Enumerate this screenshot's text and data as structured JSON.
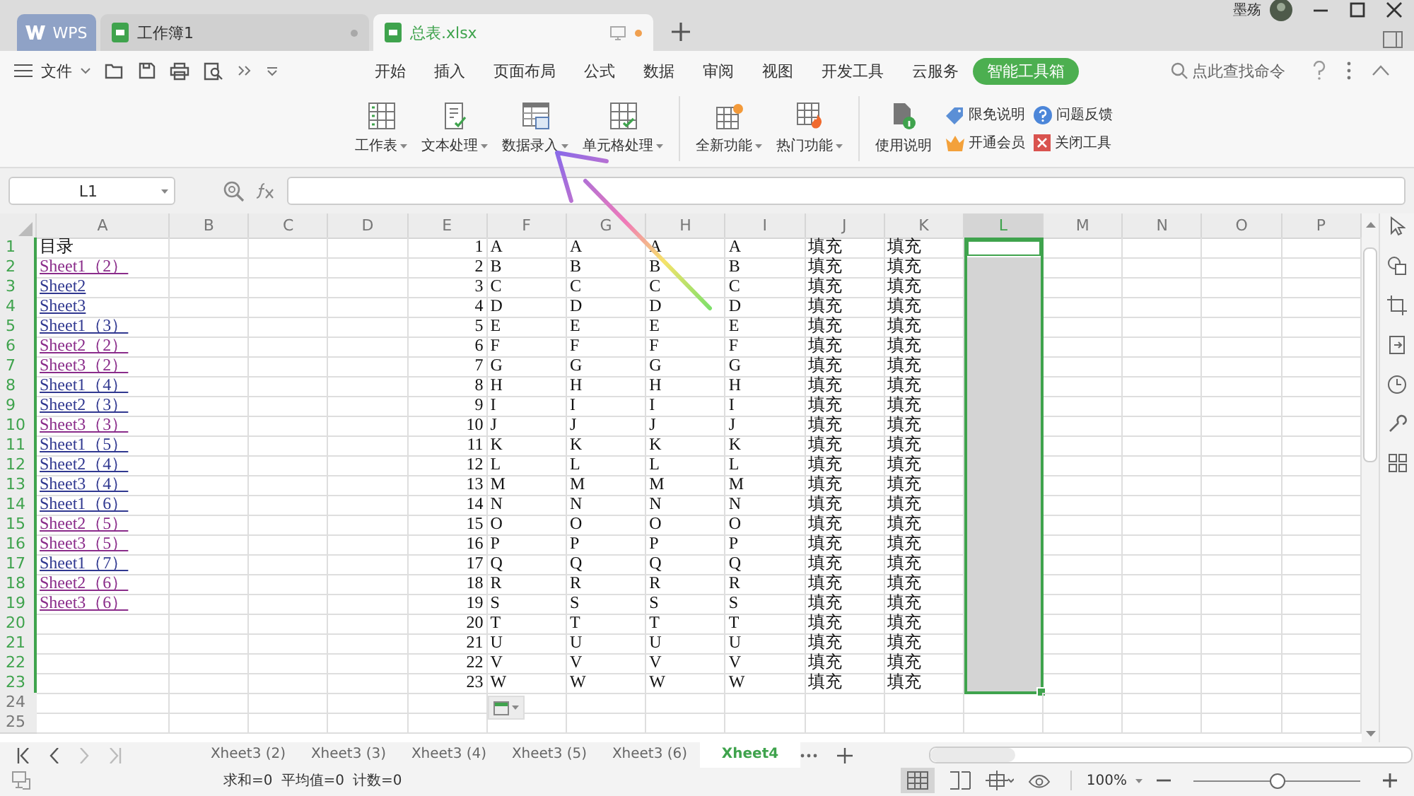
{
  "title_bar": {
    "app_tab": "WPS",
    "tabs": [
      {
        "label": "工作簿1",
        "selected": false
      },
      {
        "label": "总表.xlsx",
        "selected": true
      }
    ],
    "user": "墨殇"
  },
  "menu": {
    "file": "文件",
    "tabs": [
      {
        "label": "开始",
        "selected": false
      },
      {
        "label": "插入",
        "selected": false
      },
      {
        "label": "页面布局",
        "selected": false
      },
      {
        "label": "公式",
        "selected": false
      },
      {
        "label": "数据",
        "selected": false
      },
      {
        "label": "审阅",
        "selected": false
      },
      {
        "label": "视图",
        "selected": false
      },
      {
        "label": "开发工具",
        "selected": false
      },
      {
        "label": "云服务",
        "selected": false
      },
      {
        "label": "智能工具箱",
        "selected": true
      }
    ],
    "search": "点此查找命令"
  },
  "ribbon": {
    "large": [
      {
        "label": "工作表",
        "dropdown": true
      },
      {
        "label": "文本处理",
        "dropdown": true
      },
      {
        "label": "数据录入",
        "dropdown": true
      },
      {
        "label": "单元格处理",
        "dropdown": true
      },
      {
        "label": "全新功能",
        "dropdown": true
      },
      {
        "label": "热门功能",
        "dropdown": true
      },
      {
        "label": "使用说明",
        "dropdown": false
      }
    ],
    "small": [
      "限免说明",
      "问题反馈",
      "开通会员",
      "关闭工具"
    ]
  },
  "formula_bar": {
    "name_box": "L1"
  },
  "grid": {
    "columns": [
      {
        "label": "A",
        "selected": false
      },
      {
        "label": "B",
        "selected": false
      },
      {
        "label": "C",
        "selected": false
      },
      {
        "label": "D",
        "selected": false
      },
      {
        "label": "E",
        "selected": false
      },
      {
        "label": "F",
        "selected": false
      },
      {
        "label": "G",
        "selected": false
      },
      {
        "label": "H",
        "selected": false
      },
      {
        "label": "I",
        "selected": false
      },
      {
        "label": "J",
        "selected": false
      },
      {
        "label": "K",
        "selected": false
      },
      {
        "label": "L",
        "selected": true
      },
      {
        "label": "M",
        "selected": false
      },
      {
        "label": "N",
        "selected": false
      },
      {
        "label": "O",
        "selected": false
      },
      {
        "label": "P",
        "selected": false
      }
    ],
    "rows": [
      {
        "number": "1",
        "selected": true,
        "active": true,
        "a": {
          "kind": "text",
          "text": "目录"
        },
        "e": "1",
        "f": "A",
        "g": "A",
        "h": "A",
        "i": "A",
        "j": "填充",
        "k": "填充"
      },
      {
        "number": "2",
        "selected": true,
        "active": false,
        "a": {
          "kind": "link",
          "text": "Sheet1（2）",
          "visited": true
        },
        "e": "2",
        "f": "B",
        "g": "B",
        "h": "B",
        "i": "B",
        "j": "填充",
        "k": "填充"
      },
      {
        "number": "3",
        "selected": true,
        "active": false,
        "a": {
          "kind": "link",
          "text": "Sheet2",
          "visited": false
        },
        "e": "3",
        "f": "C",
        "g": "C",
        "h": "C",
        "i": "C",
        "j": "填充",
        "k": "填充"
      },
      {
        "number": "4",
        "selected": true,
        "active": false,
        "a": {
          "kind": "link",
          "text": "Sheet3",
          "visited": false
        },
        "e": "4",
        "f": "D",
        "g": "D",
        "h": "D",
        "i": "D",
        "j": "填充",
        "k": "填充"
      },
      {
        "number": "5",
        "selected": true,
        "active": false,
        "a": {
          "kind": "link",
          "text": "Sheet1（3）",
          "visited": false
        },
        "e": "5",
        "f": "E",
        "g": "E",
        "h": "E",
        "i": "E",
        "j": "填充",
        "k": "填充"
      },
      {
        "number": "6",
        "selected": true,
        "active": false,
        "a": {
          "kind": "link",
          "text": "Sheet2（2）",
          "visited": true
        },
        "e": "6",
        "f": "F",
        "g": "F",
        "h": "F",
        "i": "F",
        "j": "填充",
        "k": "填充"
      },
      {
        "number": "7",
        "selected": true,
        "active": false,
        "a": {
          "kind": "link",
          "text": "Sheet3（2）",
          "visited": true
        },
        "e": "7",
        "f": "G",
        "g": "G",
        "h": "G",
        "i": "G",
        "j": "填充",
        "k": "填充"
      },
      {
        "number": "8",
        "selected": true,
        "active": false,
        "a": {
          "kind": "link",
          "text": "Sheet1（4）",
          "visited": false
        },
        "e": "8",
        "f": "H",
        "g": "H",
        "h": "H",
        "i": "H",
        "j": "填充",
        "k": "填充"
      },
      {
        "number": "9",
        "selected": true,
        "active": false,
        "a": {
          "kind": "link",
          "text": "Sheet2（3）",
          "visited": false
        },
        "e": "9",
        "f": "I",
        "g": "I",
        "h": "I",
        "i": "I",
        "j": "填充",
        "k": "填充"
      },
      {
        "number": "10",
        "selected": true,
        "active": false,
        "a": {
          "kind": "link",
          "text": "Sheet3（3）",
          "visited": true
        },
        "e": "10",
        "f": "J",
        "g": "J",
        "h": "J",
        "i": "J",
        "j": "填充",
        "k": "填充"
      },
      {
        "number": "11",
        "selected": true,
        "active": false,
        "a": {
          "kind": "link",
          "text": "Sheet1（5）",
          "visited": false
        },
        "e": "11",
        "f": "K",
        "g": "K",
        "h": "K",
        "i": "K",
        "j": "填充",
        "k": "填充"
      },
      {
        "number": "12",
        "selected": true,
        "active": false,
        "a": {
          "kind": "link",
          "text": "Sheet2（4）",
          "visited": false
        },
        "e": "12",
        "f": "L",
        "g": "L",
        "h": "L",
        "i": "L",
        "j": "填充",
        "k": "填充"
      },
      {
        "number": "13",
        "selected": true,
        "active": false,
        "a": {
          "kind": "link",
          "text": "Sheet3（4）",
          "visited": false
        },
        "e": "13",
        "f": "M",
        "g": "M",
        "h": "M",
        "i": "M",
        "j": "填充",
        "k": "填充"
      },
      {
        "number": "14",
        "selected": true,
        "active": false,
        "a": {
          "kind": "link",
          "text": "Sheet1（6）",
          "visited": false
        },
        "e": "14",
        "f": "N",
        "g": "N",
        "h": "N",
        "i": "N",
        "j": "填充",
        "k": "填充"
      },
      {
        "number": "15",
        "selected": true,
        "active": false,
        "a": {
          "kind": "link",
          "text": "Sheet2（5）",
          "visited": true
        },
        "e": "15",
        "f": "O",
        "g": "O",
        "h": "O",
        "i": "O",
        "j": "填充",
        "k": "填充"
      },
      {
        "number": "16",
        "selected": true,
        "active": false,
        "a": {
          "kind": "link",
          "text": "Sheet3（5）",
          "visited": true
        },
        "e": "16",
        "f": "P",
        "g": "P",
        "h": "P",
        "i": "P",
        "j": "填充",
        "k": "填充"
      },
      {
        "number": "17",
        "selected": true,
        "active": false,
        "a": {
          "kind": "link",
          "text": "Sheet1（7）",
          "visited": false
        },
        "e": "17",
        "f": "Q",
        "g": "Q",
        "h": "Q",
        "i": "Q",
        "j": "填充",
        "k": "填充"
      },
      {
        "number": "18",
        "selected": true,
        "active": false,
        "a": {
          "kind": "link",
          "text": "Sheet2（6）",
          "visited": true
        },
        "e": "18",
        "f": "R",
        "g": "R",
        "h": "R",
        "i": "R",
        "j": "填充",
        "k": "填充"
      },
      {
        "number": "19",
        "selected": true,
        "active": false,
        "a": {
          "kind": "link",
          "text": "Sheet3（6）",
          "visited": true
        },
        "e": "19",
        "f": "S",
        "g": "S",
        "h": "S",
        "i": "S",
        "j": "填充",
        "k": "填充"
      },
      {
        "number": "20",
        "selected": true,
        "active": false,
        "e": "20",
        "f": "T",
        "g": "T",
        "h": "T",
        "i": "T",
        "j": "填充",
        "k": "填充"
      },
      {
        "number": "21",
        "selected": true,
        "active": false,
        "e": "21",
        "f": "U",
        "g": "U",
        "h": "U",
        "i": "U",
        "j": "填充",
        "k": "填充"
      },
      {
        "number": "22",
        "selected": true,
        "active": false,
        "e": "22",
        "f": "V",
        "g": "V",
        "h": "V",
        "i": "V",
        "j": "填充",
        "k": "填充"
      },
      {
        "number": "23",
        "selected": true,
        "active": false,
        "e": "23",
        "f": "W",
        "g": "W",
        "h": "W",
        "i": "W",
        "j": "填充",
        "k": "填充"
      },
      {
        "number": "24",
        "selected": false,
        "active": false
      },
      {
        "number": "25",
        "selected": false,
        "active": false
      }
    ]
  },
  "sheet_tabs": [
    {
      "label": "Xheet3 (2)",
      "selected": false
    },
    {
      "label": "Xheet3 (3)",
      "selected": false
    },
    {
      "label": "Xheet3 (4)",
      "selected": false
    },
    {
      "label": "Xheet3 (5)",
      "selected": false
    },
    {
      "label": "Xheet3 (6)",
      "selected": false
    },
    {
      "label": "Xheet4",
      "selected": true
    }
  ],
  "status_bar": {
    "stats": [
      "求和=0",
      "平均值=0",
      "计数=0"
    ],
    "zoom": "100%",
    "zoom_slider": {
      "level": 0.5
    }
  }
}
